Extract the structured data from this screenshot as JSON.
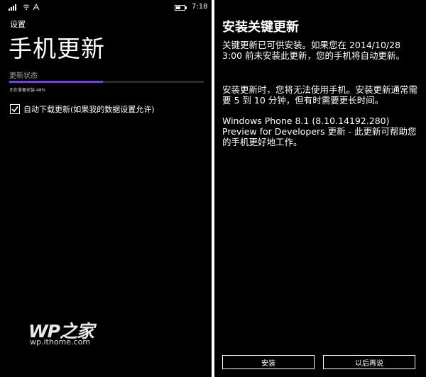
{
  "status_bar": {
    "time": "7:18",
    "battery_level": 0.5
  },
  "settings": {
    "app_label": "设置",
    "title": "手机更新",
    "section_label": "更新状态",
    "progress_text": "正在准备安装 48%",
    "progress_value": 0.48,
    "accent_color": "#7a3cf0",
    "checkbox_label": "自动下载更新(如果我的数据设置允许)",
    "checkbox_checked": true
  },
  "watermark": {
    "logo": "WP之家",
    "url": "wp.ithome.com"
  },
  "dialog": {
    "title": "安装关键更新",
    "paragraph1": "关键更新已可供安装。如果您在 2014/10/28 3:00 前未安装此更新，您的手机将自动更新。",
    "paragraph2": "安装更新时，您将无法使用手机。安装更新通常需要 5 到 10 分钟，但有时需要更长时间。",
    "paragraph3": "Windows Phone 8.1 (8.10.14192.280) Preview for Developers 更新 - 此更新可帮助您的手机更好地工作。",
    "install_label": "安装",
    "later_label": "以后再说"
  }
}
